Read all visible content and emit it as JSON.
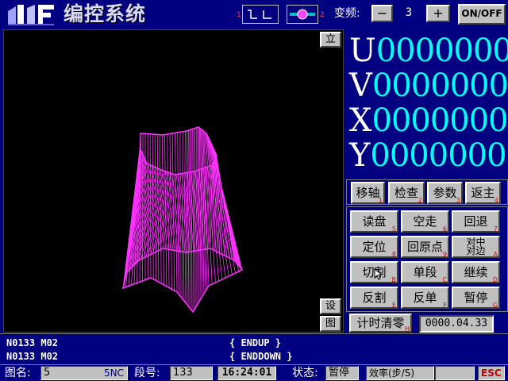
{
  "header": {
    "app_title": "编控系统",
    "freq_label": "变频:",
    "freq_minus": "−",
    "freq_value": "3",
    "freq_plus": "+",
    "onoff_label": "ON/OFF",
    "mark_1": "1",
    "mark_2": "2"
  },
  "graphics": {
    "view_button": "立",
    "settings_button": "设",
    "figure_button": "图"
  },
  "coordinates": [
    {
      "axis": "U",
      "value": "0000000"
    },
    {
      "axis": "V",
      "value": "0000000"
    },
    {
      "axis": "X",
      "value": "0000000"
    },
    {
      "axis": "Y",
      "value": "0000000"
    }
  ],
  "menu": {
    "top_buttons": [
      {
        "label": "移轴",
        "key": "1"
      },
      {
        "label": "检查",
        "key": "2"
      },
      {
        "label": "参数",
        "key": "3"
      },
      {
        "label": "返主",
        "key": "4"
      }
    ],
    "grid_buttons": [
      {
        "label": "读盘",
        "key": "5"
      },
      {
        "label": "空走",
        "key": "6"
      },
      {
        "label": "回退",
        "key": "7"
      },
      {
        "label": "定位",
        "key": "8"
      },
      {
        "label": "回原点",
        "key": "9"
      },
      {
        "label_line1": "对中",
        "label_line2": "对边",
        "key": "A"
      },
      {
        "label": "切割",
        "key": "B"
      },
      {
        "label": "单段",
        "key": "C"
      },
      {
        "label": "继续",
        "key": "D"
      },
      {
        "label": "反割",
        "key": "E"
      },
      {
        "label": "反单",
        "key": "F"
      },
      {
        "label": "暂停",
        "key": "G"
      }
    ],
    "timer_button": {
      "label": "计时清零",
      "key": "H"
    },
    "timer_value": "0000.04.33"
  },
  "messages": {
    "line1_code": "N0133 M02",
    "line1_note": "{ ENDUP }",
    "line2_code": "N0133 M02",
    "line2_note": "{ ENDDOWN }"
  },
  "statusbar": {
    "figure_label": "图名:",
    "figure_name": "5",
    "figure_ext": "5NC",
    "segment_label": "段号:",
    "segment_value": "133",
    "time": "16:24:01",
    "state_label": "状态:",
    "state_value": "暂停",
    "efficiency_label": "效率(步/S)",
    "efficiency_value": "",
    "esc_label": "ESC"
  },
  "colors": {
    "background": "#000080",
    "coord_digits": "#00ffff",
    "wireframe": "#ff33ff",
    "button_face": "#c0c0c0",
    "key_hint": "#e00000"
  }
}
